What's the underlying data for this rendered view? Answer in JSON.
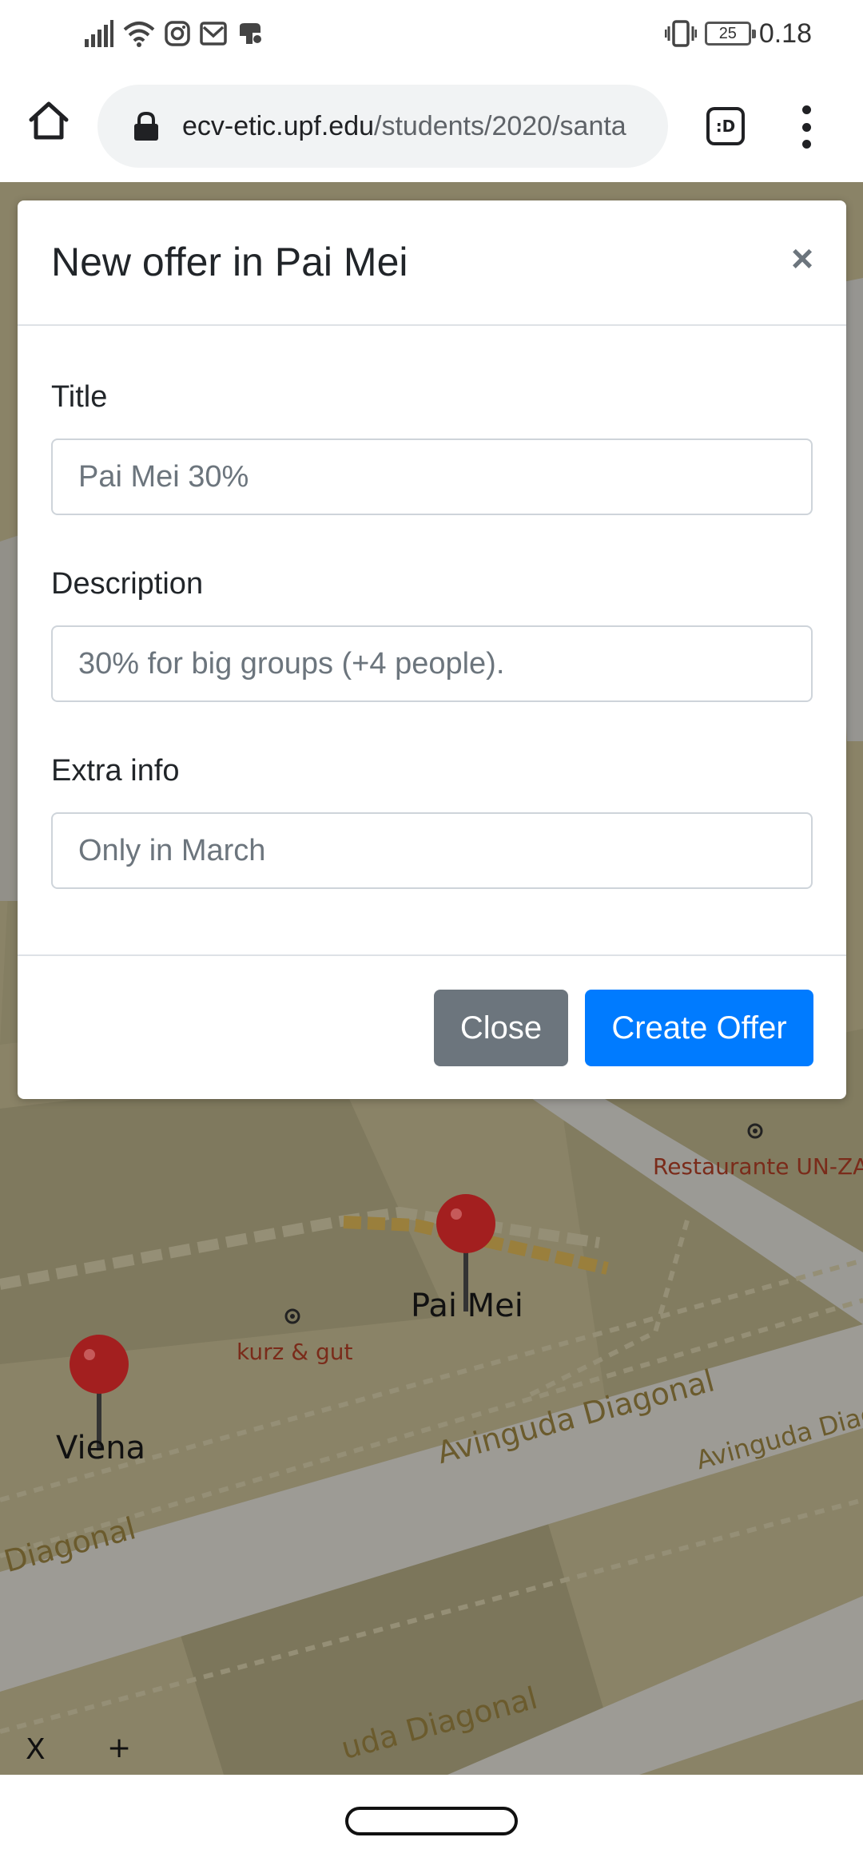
{
  "status_bar": {
    "time": "0.18",
    "battery": "25",
    "icons": [
      "signal-icon",
      "wifi-icon",
      "instagram-icon",
      "mail-icon",
      "game-icon",
      "vibrate-icon",
      "battery-icon"
    ]
  },
  "browser": {
    "url_domain": "ecv-etic.upf.edu",
    "url_path": "/students/2020/santa",
    "tab_button": ":D"
  },
  "map": {
    "pois": [
      {
        "label": "Restaurante UN-ZA"
      },
      {
        "label": "kurz & gut"
      }
    ],
    "pins": [
      {
        "label": "Pai Mei"
      },
      {
        "label": "Viena"
      }
    ],
    "streets": [
      "Avinguda Diagonal",
      "Avinguda Diag",
      "Diagonal",
      "uda Diagonal"
    ],
    "controls": {
      "close": "X",
      "zoom_in": "+"
    }
  },
  "modal": {
    "title": "New offer in Pai Mei",
    "close_symbol": "×",
    "fields": {
      "title": {
        "label": "Title",
        "placeholder": "Pai Mei 30%"
      },
      "description": {
        "label": "Description",
        "placeholder": "30% for big groups (+4 people)."
      },
      "extra": {
        "label": "Extra info",
        "placeholder": "Only in March"
      }
    },
    "buttons": {
      "close": "Close",
      "create": "Create Offer"
    }
  }
}
